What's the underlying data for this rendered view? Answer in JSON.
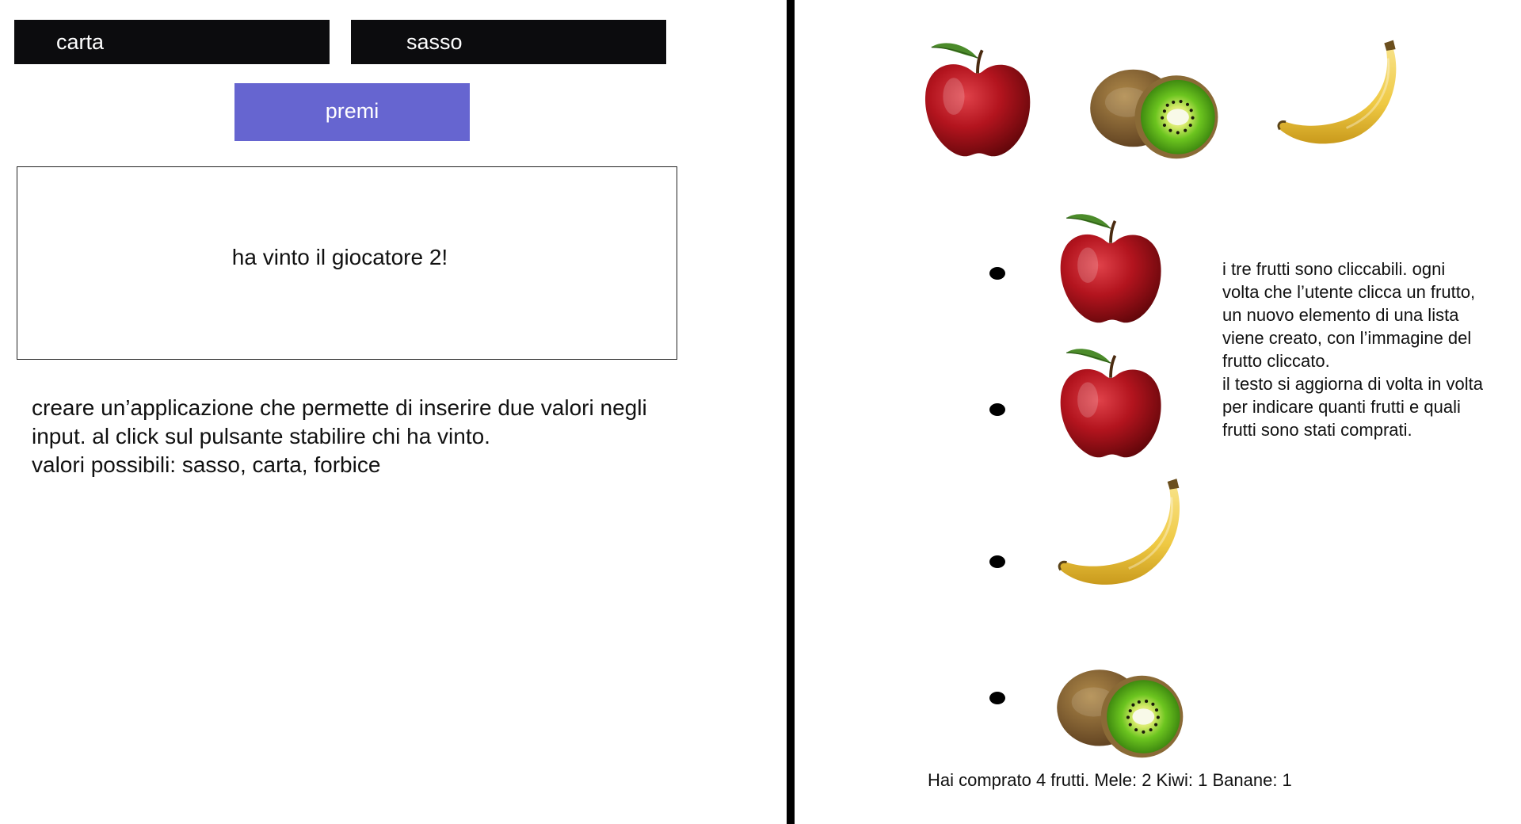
{
  "game": {
    "player1_value": "carta",
    "player2_value": "sasso",
    "button_label": "premi",
    "result": "ha vinto il giocatore 2!",
    "instructions": [
      "creare un’applicazione che permette di inserire due valori negli",
      "input. al click sul pulsante stabilire chi ha vinto.",
      "valori possibili: sasso, carta, forbice"
    ]
  },
  "shop": {
    "fruits": [
      "apple-icon",
      "kiwi-icon",
      "banana-icon"
    ],
    "purchased_list": [
      "apple-icon",
      "apple-icon",
      "banana-icon",
      "kiwi-icon"
    ],
    "description": [
      "i tre frutti sono cliccabili. ogni",
      "volta che l’utente clicca un frutto,",
      "un nuovo elemento di una lista",
      "viene creato, con l’immagine del",
      "frutto cliccato.",
      "il testo si aggiorna di volta in volta",
      "per indicare quanti frutti e quali",
      "frutti sono stati comprati."
    ],
    "summary": "Hai comprato 4 frutti. Mele: 2 Kiwi: 1 Banane: 1"
  },
  "colors": {
    "input_bg": "#0c0c0e",
    "button_bg": "#6665d0",
    "divider": "#000000"
  }
}
